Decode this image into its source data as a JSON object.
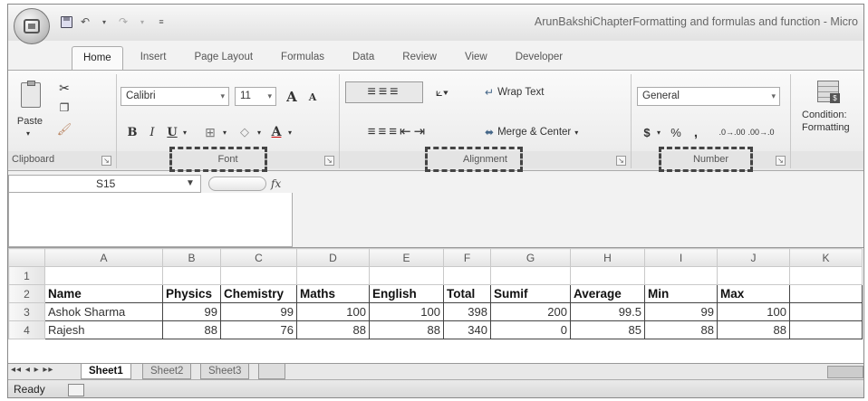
{
  "window": {
    "title": "ArunBakshiChapterFormatting and formulas and function - Micro"
  },
  "tabs": [
    "Home",
    "Insert",
    "Page Layout",
    "Formulas",
    "Data",
    "Review",
    "View",
    "Developer"
  ],
  "ribbon": {
    "clipboard": {
      "paste": "Paste",
      "label": "Clipboard"
    },
    "font": {
      "name": "Calibri",
      "size": "11",
      "bold": "B",
      "italic": "I",
      "underline": "U",
      "grow": "A",
      "shrink": "A",
      "color_a": "A",
      "label": "Font"
    },
    "alignment": {
      "wrap": "Wrap Text",
      "merge": "Merge & Center",
      "label": "Alignment"
    },
    "number": {
      "format": "General",
      "currency": "$",
      "percent": "%",
      "comma": ",",
      "inc_dec": ".0→.00",
      "dec_dec": ".00→.0",
      "label": "Number"
    },
    "styles": {
      "conditional_line1": "Condition:",
      "conditional_line2": "Formatting"
    }
  },
  "formula_bar": {
    "name_box": "S15",
    "fx": "fx"
  },
  "grid": {
    "columns": [
      "A",
      "B",
      "C",
      "D",
      "E",
      "F",
      "G",
      "H",
      "I",
      "J",
      "K"
    ],
    "row_numbers": [
      "1",
      "2",
      "3",
      "4"
    ],
    "headers": [
      "Name",
      "Physics",
      "Chemistry",
      "Maths",
      "English",
      "Total",
      "Sumif",
      "Average",
      "Min",
      "Max"
    ],
    "row3": [
      "Ashok Sharma",
      "99",
      "99",
      "100",
      "100",
      "398",
      "200",
      "99.5",
      "99",
      "100"
    ],
    "row4": [
      "Rajesh",
      "88",
      "76",
      "88",
      "88",
      "340",
      "0",
      "85",
      "88",
      "88"
    ]
  },
  "sheets": [
    "Sheet1",
    "Sheet2",
    "Sheet3"
  ],
  "status": {
    "text": "Ready"
  }
}
